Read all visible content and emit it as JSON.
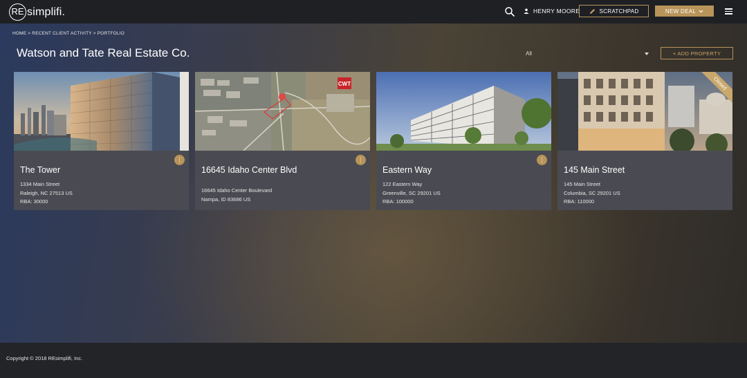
{
  "app": {
    "logo_mark": "RE",
    "logo_word": "simplifi."
  },
  "topbar": {
    "user_name": "HENRY MOORE",
    "scratchpad_label": "SCRATCHPAD",
    "new_deal_label": "NEW DEAL",
    "accent_color": "#b8945a"
  },
  "breadcrumb": "HOME > RECENT CLIENT ACTIVITY > PORTFOLIO",
  "page": {
    "title": "Watson and Tate Real Estate Co.",
    "filter_value": "All",
    "add_property_label": "+ ADD PROPERTY"
  },
  "properties": [
    {
      "name": "The Tower",
      "address1": "1334 Main Street",
      "address2": "Raleigh, NC 27513 US",
      "rba": "RBA: 30000",
      "has_menu": true,
      "image": "glass-office-tower-photo"
    },
    {
      "name": "16645 Idaho Center Blvd",
      "address1": "16645 Idaho Center Boulevard",
      "address2": "Nampa, ID 83686 US",
      "rba": "",
      "has_menu": true,
      "image": "aerial-map-photo",
      "map_badge": "CWT"
    },
    {
      "name": "Eastern Way",
      "address1": "122 Eastern Way",
      "address2": "Greenville, SC 29201 US",
      "rba": "RBA: 100000",
      "has_menu": true,
      "image": "modern-office-building-rendering"
    },
    {
      "name": "145 Main Street",
      "address1": "145 Main Street",
      "address2": "Columbia, SC 29201 US",
      "rba": "RBA: 110000",
      "has_menu": false,
      "image": "downtown-building-photo",
      "ribbon": "Closed"
    }
  ],
  "footer": {
    "copyright": "Copyright © 2018 REsimplifi, Inc."
  }
}
